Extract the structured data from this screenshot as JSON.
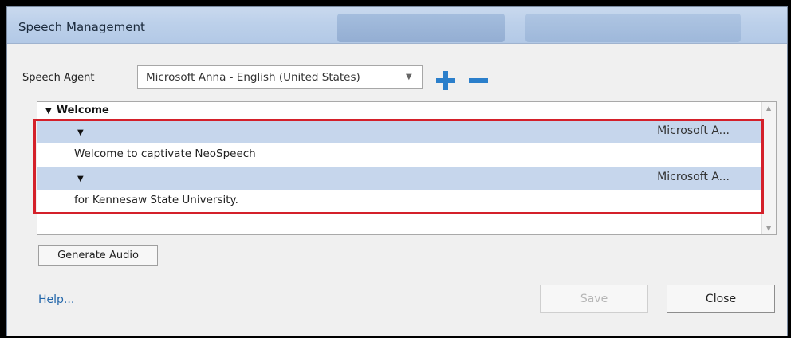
{
  "window": {
    "title": "Speech Management"
  },
  "agent": {
    "label": "Speech Agent",
    "selected": "Microsoft Anna - English (United States)"
  },
  "group": {
    "title": "Welcome"
  },
  "rows": [
    {
      "agent": "Microsoft A...",
      "text": "Welcome to captivate NeoSpeech"
    },
    {
      "agent": "Microsoft A...",
      "text": "for Kennesaw State University."
    }
  ],
  "buttons": {
    "generate": "Generate Audio",
    "help": "Help...",
    "save": "Save",
    "close": "Close"
  },
  "colors": {
    "accent": "#2b7fcb",
    "highlight": "#d4202a",
    "row_header": "#c6d6ec"
  },
  "icons": {
    "add": "plus-icon",
    "remove": "minus-icon",
    "expand": "triangle-down-icon"
  }
}
